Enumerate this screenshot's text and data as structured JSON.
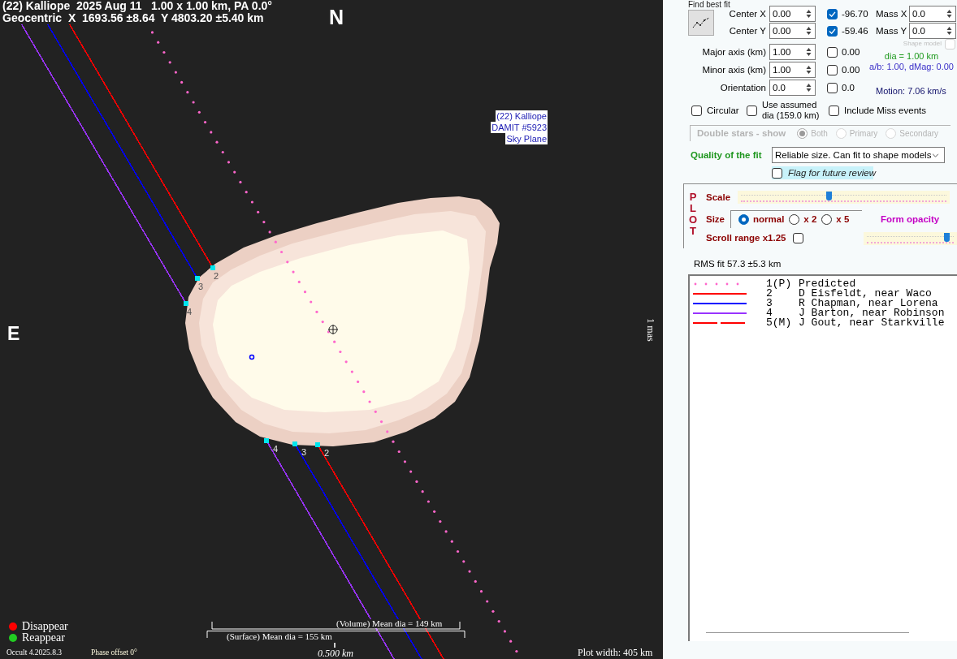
{
  "plot": {
    "title": "(22) Kalliope  2025 Aug 11   1.00 x 1.00 km, PA 0.0°",
    "geocentric": "Geocentric  X  1693.56 ±8.64  Y 4803.20 ±5.40 km",
    "north": "N",
    "east": "E",
    "model_label": [
      "(22) Kalliope",
      "DAMIT #5923",
      "Sky Plane"
    ],
    "angular_scale": "1 mas",
    "chords": [
      {
        "color": "#9933ff",
        "entry_label": "4",
        "exit_label": "4"
      },
      {
        "color": "#0000ff",
        "entry_label": "3",
        "exit_label": "3"
      },
      {
        "color": "#ff0000",
        "entry_label": "2",
        "exit_label": "2"
      }
    ],
    "event_key": [
      {
        "label": "Disappear",
        "color": "#ff0000"
      },
      {
        "label": "Reappear",
        "color": "#22cc22"
      }
    ],
    "volume_mean_dia": "(Volume) Mean dia = 149 km",
    "surface_mean_dia": "(Surface) Mean dia = 155 km",
    "version": "Occult 4.2025.8.3",
    "phase_offset": "Phase offset 0°",
    "scale_bar": "0.500 km",
    "plot_width": "Plot width: 405 km"
  },
  "fit": {
    "find_best_fit": "Find best fit",
    "center_rows": [
      {
        "label": "Center X",
        "value": "0.00",
        "checked": true,
        "result": "-96.70",
        "mass_label": "Mass X",
        "mass_value": "0.0"
      },
      {
        "label": "Center Y",
        "value": "0.00",
        "checked": true,
        "result": "-59.46",
        "mass_label": "Mass Y",
        "mass_value": "0.0"
      }
    ],
    "shape_model": {
      "label": "Shape model",
      "checked": false,
      "disabled": true
    },
    "axis_rows": [
      {
        "label": "Major axis (km)",
        "value": "1.00",
        "checked": false,
        "result": "0.00"
      },
      {
        "label": "Minor axis (km)",
        "value": "1.00",
        "checked": false,
        "result": "0.00"
      },
      {
        "label": "Orientation",
        "value": "0.0",
        "checked": false,
        "result": "0.0"
      }
    ],
    "dia_text": "dia = 1.00 km",
    "ratio_text": "a/b: 1.00, dMag: 0.00",
    "motion_text": "Motion: 7.06 km/s",
    "options": [
      {
        "label": "Circular",
        "checked": false
      },
      {
        "label": "Use assumed dia (159.0 km)",
        "checked": false
      },
      {
        "label": "Include Miss events",
        "checked": false
      }
    ],
    "double_stars": {
      "title": "Double stars - show",
      "disabled": true,
      "options": [
        {
          "label": "Both",
          "selected": true
        },
        {
          "label": "Primary",
          "selected": false
        },
        {
          "label": "Secondary",
          "selected": false
        }
      ]
    },
    "quality": {
      "label": "Quality of the fit",
      "value": "Reliable size. Can fit to shape models"
    },
    "flag_review": {
      "label": "Flag for future review",
      "checked": false
    }
  },
  "plot_settings": {
    "heading": "PLOT",
    "scale": {
      "label": "Scale",
      "level": 0.43
    },
    "size": {
      "label": "Size",
      "options": [
        {
          "label": "normal",
          "selected": true
        },
        {
          "label": "x 2",
          "selected": false
        },
        {
          "label": "x 5",
          "selected": false
        }
      ]
    },
    "form_opacity": {
      "label": "Form opacity",
      "level": 0.92
    },
    "scroll_range": {
      "label": "Scroll range x1.25",
      "checked": false
    }
  },
  "rms_fit": "RMS fit 57.3 ±5.3 km",
  "legend": [
    {
      "kind": "dotted",
      "color": "#ff66cc",
      "number": "1(P)",
      "name": "Predicted"
    },
    {
      "kind": "solid",
      "color": "#ff0000",
      "number": "2",
      "name": "D Eisfeldt, near Waco"
    },
    {
      "kind": "solid",
      "color": "#0000ff",
      "number": "3",
      "name": "R Chapman, near Lorena"
    },
    {
      "kind": "solid",
      "color": "#9933ff",
      "number": "4",
      "name": "J Barton, near Robinson"
    },
    {
      "kind": "dashed",
      "color": "#ff0000",
      "number": "5(M)",
      "name": "J Gout, near Starkville"
    }
  ]
}
